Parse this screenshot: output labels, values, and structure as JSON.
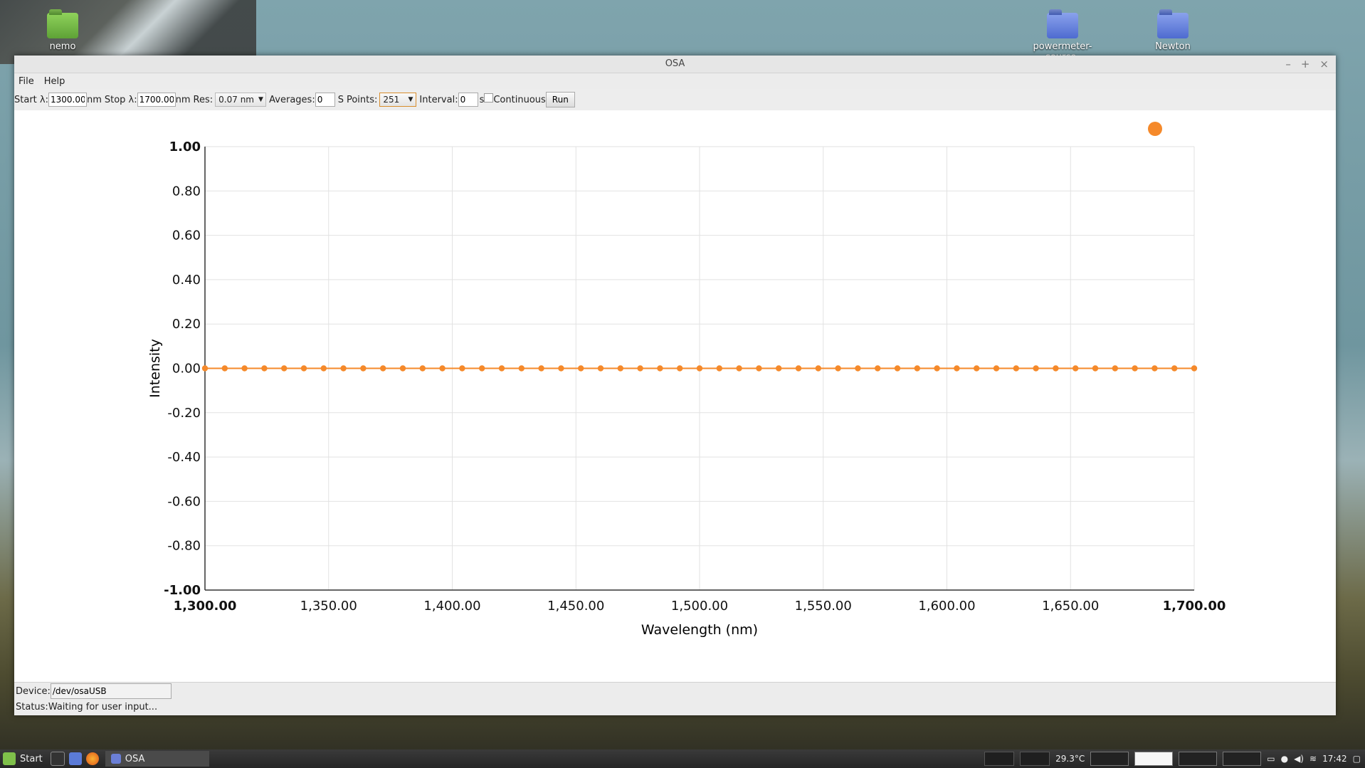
{
  "desktop": {
    "icons": [
      "nemo",
      "powermeter-source-",
      "Newton"
    ]
  },
  "window": {
    "title": "OSA",
    "controls": {
      "minimize": "–",
      "maximize": "+",
      "close": "×"
    }
  },
  "menu": {
    "file": "File",
    "help": "Help"
  },
  "toolbar": {
    "start_label": "Start λ:",
    "start_value": "1300.00",
    "start_unit": "nm",
    "stop_label": "Stop λ:",
    "stop_value": "1700.00",
    "stop_unit": "nm",
    "res_label": "Res:",
    "res_value": "0.07 nm",
    "averages_label": "Averages:",
    "averages_value": "0",
    "points_unit_label": "S",
    "points_label": "Points:",
    "points_value": "251",
    "interval_label": "Interval:",
    "interval_value": "0",
    "interval_unit": "s",
    "continuous_label": "Continuous",
    "run_label": "Run"
  },
  "chart_data": {
    "type": "line",
    "xlabel": "Wavelength (nm)",
    "ylabel": "Intensity",
    "xlim": [
      1300,
      1700
    ],
    "ylim": [
      -1,
      1
    ],
    "x_ticks": [
      "1,300.00",
      "1,350.00",
      "1,400.00",
      "1,450.00",
      "1,500.00",
      "1,550.00",
      "1,600.00",
      "1,650.00",
      "1,700.00"
    ],
    "y_ticks": [
      "1.00",
      "0.80",
      "0.60",
      "0.40",
      "0.20",
      "0.00",
      "-0.20",
      "-0.40",
      "-0.60",
      "-0.80",
      "-1.00"
    ],
    "grid": true,
    "series_color": "#f5892a",
    "series": [
      {
        "x": [
          1300,
          1308,
          1316,
          1324,
          1332,
          1340,
          1348,
          1356,
          1364,
          1372,
          1380,
          1388,
          1396,
          1404,
          1412,
          1420,
          1428,
          1436,
          1444,
          1452,
          1460,
          1468,
          1476,
          1484,
          1492,
          1500,
          1508,
          1516,
          1524,
          1532,
          1540,
          1548,
          1556,
          1564,
          1572,
          1580,
          1588,
          1596,
          1604,
          1612,
          1620,
          1628,
          1636,
          1644,
          1652,
          1660,
          1668,
          1676,
          1684,
          1692,
          1700
        ],
        "values": [
          0,
          0,
          0,
          0,
          0,
          0,
          0,
          0,
          0,
          0,
          0,
          0,
          0,
          0,
          0,
          0,
          0,
          0,
          0,
          0,
          0,
          0,
          0,
          0,
          0,
          0,
          0,
          0,
          0,
          0,
          0,
          0,
          0,
          0,
          0,
          0,
          0,
          0,
          0,
          0,
          0,
          0,
          0,
          0,
          0,
          0,
          0,
          0,
          0,
          0,
          0
        ]
      }
    ]
  },
  "statusbar": {
    "device_label": "Device:",
    "device_value": "/dev/osaUSB",
    "status_label": "Status:",
    "status_text": "Waiting for user input..."
  },
  "taskbar": {
    "start_label": "Start",
    "task_label": "OSA",
    "temperature": "29.3°C",
    "clock": "17:42"
  }
}
